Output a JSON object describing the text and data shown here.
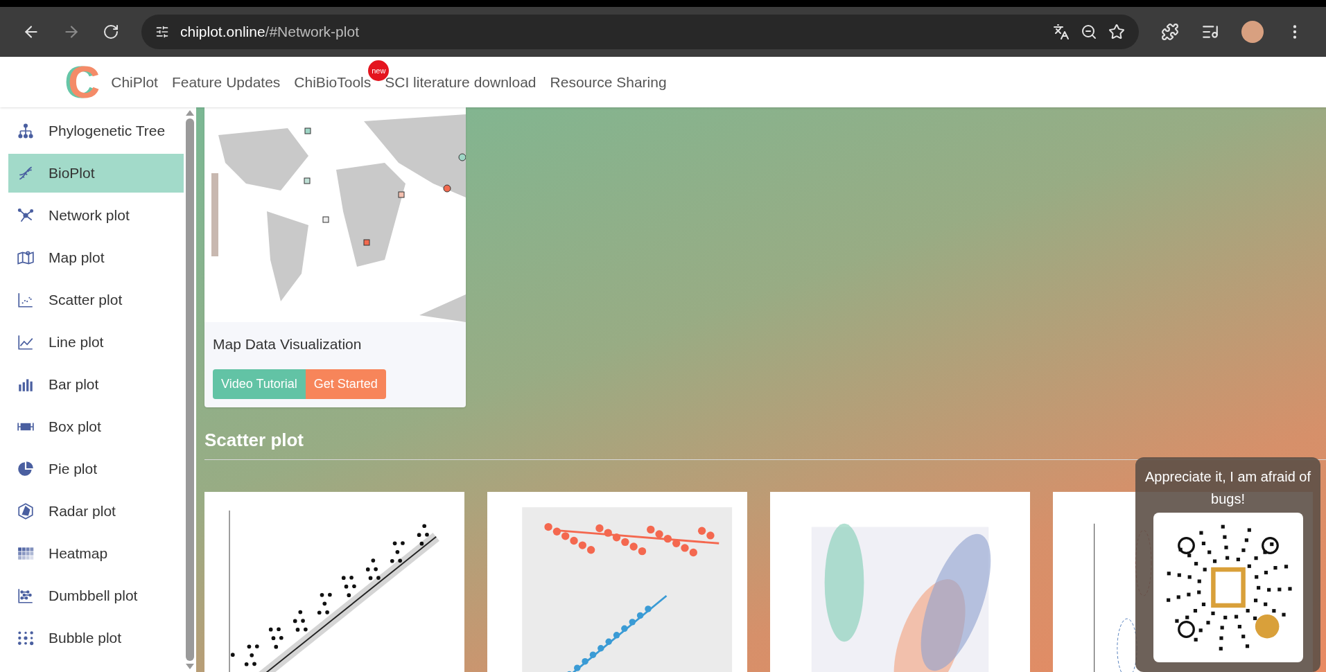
{
  "browser": {
    "url_host": "chiplot.online",
    "url_path": "/#Network-plot"
  },
  "nav": {
    "logo_letter": "C",
    "items": [
      {
        "label": "ChiPlot"
      },
      {
        "label": "Feature Updates"
      },
      {
        "label": "ChiBioTools",
        "badge": "new"
      },
      {
        "label": "SCI literature download"
      },
      {
        "label": "Resource Sharing"
      }
    ]
  },
  "sidebar": {
    "items": [
      {
        "label": "Phylogenetic Tree",
        "kind": "tree",
        "selected": false
      },
      {
        "label": "BioPlot",
        "kind": "dna",
        "selected": true
      },
      {
        "label": "Network plot",
        "kind": "network",
        "selected": false
      },
      {
        "label": "Map plot",
        "kind": "map",
        "selected": false
      },
      {
        "label": "Scatter plot",
        "kind": "scatter",
        "selected": false
      },
      {
        "label": "Line plot",
        "kind": "line",
        "selected": false
      },
      {
        "label": "Bar plot",
        "kind": "bar",
        "selected": false
      },
      {
        "label": "Box plot",
        "kind": "box",
        "selected": false
      },
      {
        "label": "Pie plot",
        "kind": "pie",
        "selected": false
      },
      {
        "label": "Radar plot",
        "kind": "radar",
        "selected": false
      },
      {
        "label": "Heatmap",
        "kind": "heatmap",
        "selected": false
      },
      {
        "label": "Dumbbell plot",
        "kind": "dumbbell",
        "selected": false
      },
      {
        "label": "Bubble plot",
        "kind": "bubble",
        "selected": false
      }
    ]
  },
  "map_card": {
    "title": "Map Data Visualization",
    "buttons": [
      {
        "label": "Video Tutorial",
        "kind": "tutorial"
      },
      {
        "label": "Get Started",
        "kind": "start"
      }
    ]
  },
  "section": {
    "heading": "Scatter plot",
    "cards": [
      {
        "kind": "regression"
      },
      {
        "kind": "trend"
      },
      {
        "kind": "ellipse"
      },
      {
        "kind": "pca"
      }
    ]
  },
  "popup": {
    "message": "Appreciate it, I am afraid of bugs!"
  }
}
